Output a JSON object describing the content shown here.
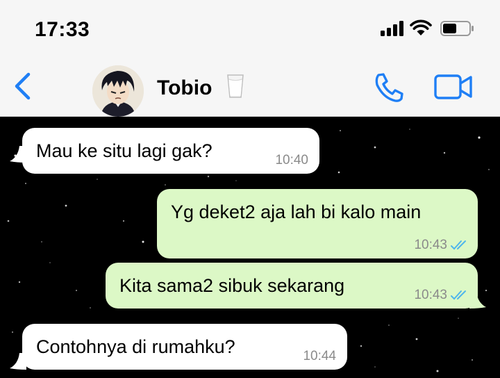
{
  "status_bar": {
    "time": "17:33"
  },
  "header": {
    "back_icon": "chevron-left-icon",
    "contact_name": "Tobio",
    "name_emoji": "milk-glass",
    "call_icon": "phone-icon",
    "video_icon": "video-camera-icon",
    "accent_color": "#1f7ff5"
  },
  "messages": [
    {
      "direction": "incoming",
      "text": "Mau ke situ lagi gak?",
      "time": "10:40"
    },
    {
      "direction": "outgoing",
      "text": "Yg deket2 aja lah bi kalo main",
      "time": "10:43",
      "status": "read"
    },
    {
      "direction": "outgoing",
      "text": "Kita sama2 sibuk sekarang",
      "time": "10:43",
      "status": "read"
    },
    {
      "direction": "incoming",
      "text": "Contohnya di rumahku?",
      "time": "10:44"
    }
  ],
  "colors": {
    "incoming_bubble": "#ffffff",
    "outgoing_bubble": "#dcf8c6",
    "read_tick": "#4fb6ec",
    "chat_background": "#000000"
  }
}
